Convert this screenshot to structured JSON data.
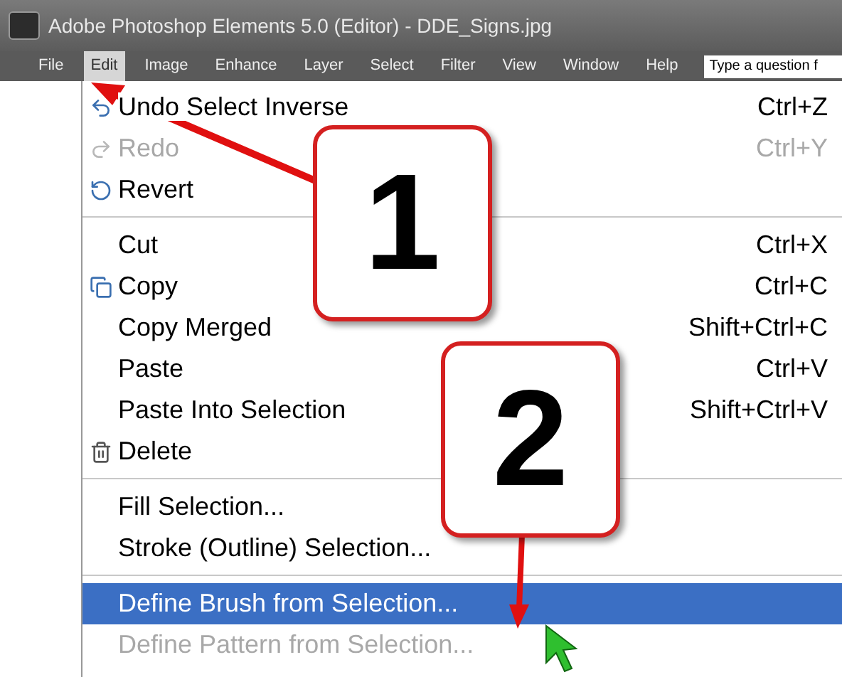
{
  "window": {
    "title": "Adobe Photoshop Elements 5.0 (Editor) - DDE_Signs.jpg"
  },
  "menubar": {
    "items": [
      {
        "label": "File",
        "selected": false
      },
      {
        "label": "Edit",
        "selected": true
      },
      {
        "label": "Image",
        "selected": false
      },
      {
        "label": "Enhance",
        "selected": false
      },
      {
        "label": "Layer",
        "selected": false
      },
      {
        "label": "Select",
        "selected": false
      },
      {
        "label": "Filter",
        "selected": false
      },
      {
        "label": "View",
        "selected": false
      },
      {
        "label": "Window",
        "selected": false
      },
      {
        "label": "Help",
        "selected": false
      }
    ],
    "search": {
      "placeholder": "Type a question f"
    }
  },
  "edit_menu": {
    "sections": [
      {
        "items": [
          {
            "kind": "undo",
            "label": "Undo Select Inverse",
            "shortcut": "Ctrl+Z",
            "disabled": false,
            "selected": false
          },
          {
            "kind": "redo",
            "label": "Redo",
            "shortcut": "Ctrl+Y",
            "disabled": true,
            "selected": false
          },
          {
            "kind": "revert",
            "label": "Revert",
            "disabled": false,
            "selected": false
          }
        ]
      },
      {
        "items": [
          {
            "kind": "plain",
            "label": "Cut",
            "shortcut": "Ctrl+X",
            "disabled": false,
            "selected": false
          },
          {
            "kind": "copy",
            "label": "Copy",
            "shortcut": "Ctrl+C",
            "disabled": false,
            "selected": false
          },
          {
            "kind": "plain",
            "label": "Copy Merged",
            "shortcut": "Shift+Ctrl+C",
            "disabled": false,
            "selected": false
          },
          {
            "kind": "plain",
            "label": "Paste",
            "shortcut": "Ctrl+V",
            "disabled": false,
            "selected": false
          },
          {
            "kind": "plain",
            "label": "Paste Into Selection",
            "shortcut": "Shift+Ctrl+V",
            "disabled": false,
            "selected": false
          },
          {
            "kind": "delete",
            "label": "Delete",
            "disabled": false,
            "selected": false
          }
        ]
      },
      {
        "items": [
          {
            "kind": "plain",
            "label": "Fill Selection...",
            "disabled": false,
            "selected": false
          },
          {
            "kind": "plain",
            "label": "Stroke (Outline) Selection...",
            "disabled": false,
            "selected": false
          }
        ]
      },
      {
        "items": [
          {
            "kind": "plain",
            "label": "Define Brush from Selection...",
            "disabled": false,
            "selected": true
          },
          {
            "kind": "plain",
            "label": "Define Pattern from Selection...",
            "disabled": true,
            "selected": false
          }
        ]
      }
    ]
  },
  "callouts": [
    {
      "label": "1"
    },
    {
      "label": "2"
    }
  ]
}
